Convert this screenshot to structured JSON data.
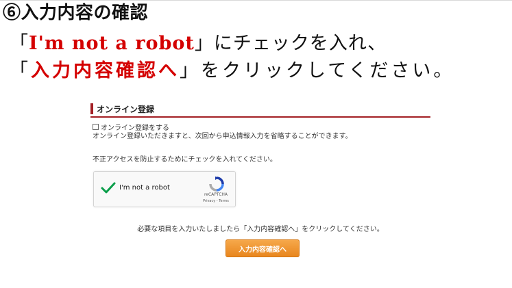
{
  "step": {
    "title": "⑥入力内容の確認"
  },
  "instructions": {
    "line1": {
      "open": "「",
      "highlight": "I'm not a robot",
      "close": "」にチェックを入れ、"
    },
    "line2": {
      "open": "「",
      "highlight": "入力内容確認へ",
      "close": "」をクリックしてください。"
    }
  },
  "screenshot": {
    "section_title": "オンライン登録",
    "checkbox_label": "オンライン登録をする",
    "checkbox_checked": false,
    "note_1": "オンライン登録いただきますと、次回から申込情報入力を省略することができます。",
    "note_2": "不正アクセスを防止するためにチェックを入れてください。",
    "captcha": {
      "label": "I'm not a robot",
      "checked": true,
      "brand": "reCAPTCHA",
      "links": "Privacy - Terms"
    },
    "note_3": "必要な項目を入力いたしましたら「入力内容確認へ」をクリックしてください。",
    "confirm_button": "入力内容確認へ"
  },
  "colors": {
    "highlight_red": "#d40000",
    "section_accent": "#a31f24",
    "button_orange": "#f0962f",
    "check_green": "#0a9e4a"
  }
}
